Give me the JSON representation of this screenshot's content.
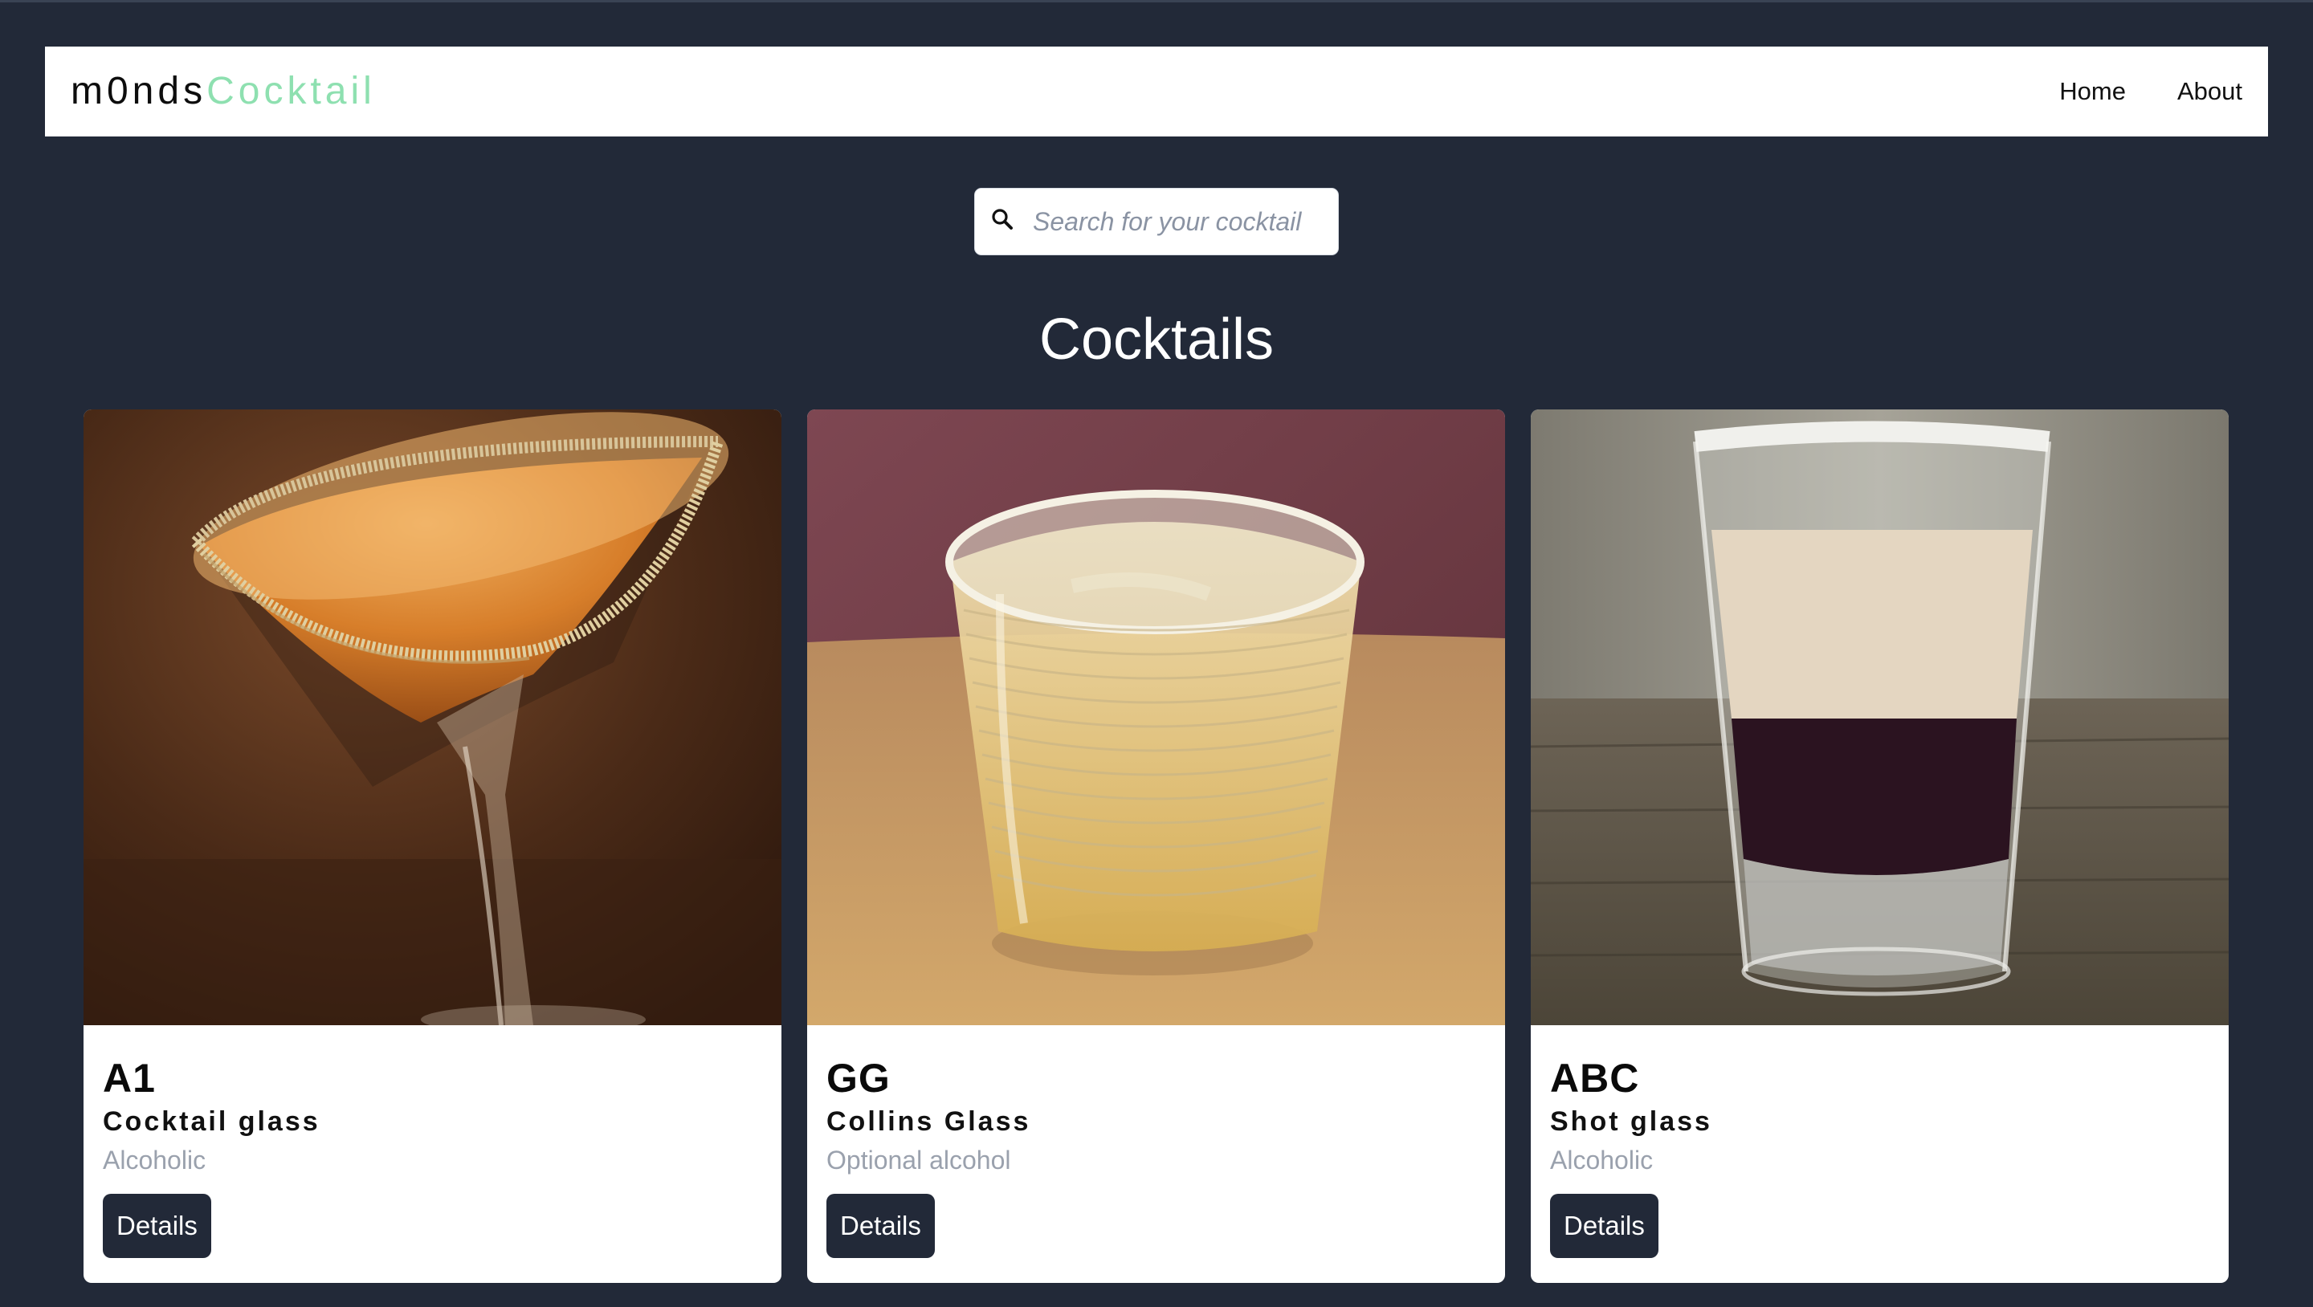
{
  "brand": {
    "name_part1": "m0nds",
    "name_part2": "Cocktail",
    "accent_color": "#8ee0b0"
  },
  "nav": {
    "items": [
      {
        "label": "Home"
      },
      {
        "label": "About"
      }
    ]
  },
  "search": {
    "placeholder": "Search for your cocktail",
    "value": "",
    "icon": "search-icon"
  },
  "page": {
    "title": "Cocktails",
    "background_color": "#222938"
  },
  "cocktails": [
    {
      "name": "A1",
      "glass": "Cocktail glass",
      "alcoholic": "Alcoholic",
      "button_label": "Details"
    },
    {
      "name": "GG",
      "glass": "Collins Glass",
      "alcoholic": "Optional alcohol",
      "button_label": "Details"
    },
    {
      "name": "ABC",
      "glass": "Shot glass",
      "alcoholic": "Alcoholic",
      "button_label": "Details"
    }
  ]
}
